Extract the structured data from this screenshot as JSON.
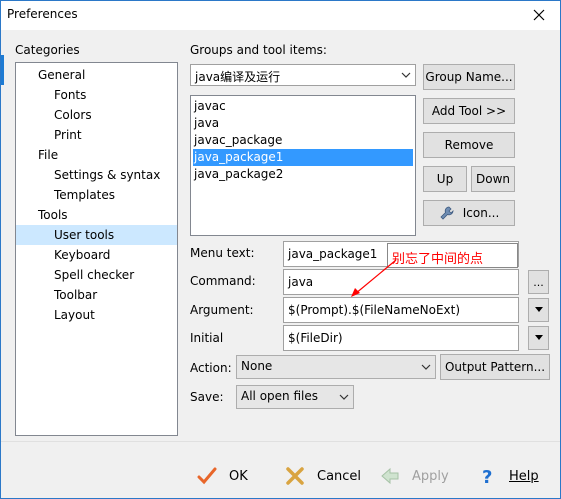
{
  "window": {
    "title": "Preferences",
    "close_icon": "close-icon"
  },
  "categories": {
    "label": "Categories",
    "items": [
      {
        "label": "General",
        "level": 0,
        "selected": false
      },
      {
        "label": "Fonts",
        "level": 1,
        "selected": false
      },
      {
        "label": "Colors",
        "level": 1,
        "selected": false
      },
      {
        "label": "Print",
        "level": 1,
        "selected": false
      },
      {
        "label": "File",
        "level": 0,
        "selected": false
      },
      {
        "label": "Settings & syntax",
        "level": 1,
        "selected": false
      },
      {
        "label": "Templates",
        "level": 1,
        "selected": false
      },
      {
        "label": "Tools",
        "level": 0,
        "selected": false
      },
      {
        "label": "User tools",
        "level": 1,
        "selected": true
      },
      {
        "label": "Keyboard",
        "level": 1,
        "selected": false
      },
      {
        "label": "Spell checker",
        "level": 1,
        "selected": false
      },
      {
        "label": "Toolbar",
        "level": 1,
        "selected": false
      },
      {
        "label": "Layout",
        "level": 1,
        "selected": false
      }
    ]
  },
  "groups": {
    "label": "Groups and tool items:",
    "selected_group": "java编译及运行",
    "group_name_button": "Group Name...",
    "add_tool_button": "Add Tool >>",
    "remove_button": "Remove",
    "up_button": "Up",
    "down_button": "Down",
    "icon_button": "Icon...",
    "items": [
      {
        "label": "javac",
        "selected": false
      },
      {
        "label": "java",
        "selected": false
      },
      {
        "label": "javac_package",
        "selected": false
      },
      {
        "label": "java_package1",
        "selected": true
      },
      {
        "label": "java_package2",
        "selected": false
      }
    ]
  },
  "form": {
    "menu_text_label": "Menu text:",
    "menu_text_value": "java_package1",
    "command_label": "Command:",
    "command_value": "java",
    "command_browse": "...",
    "argument_label": "Argument:",
    "argument_value": "$(Prompt).$(FileNameNoExt)",
    "initial_label": "Initial",
    "initial_value": "$(FileDir)",
    "action_label": "Action:",
    "action_value": "None",
    "output_pattern_button": "Output Pattern...",
    "save_label": "Save:",
    "save_value": "All open files"
  },
  "annotation": {
    "text": "别忘了中间的点",
    "color": "#ff0000"
  },
  "buttons": {
    "ok": "OK",
    "cancel": "Cancel",
    "apply": "Apply",
    "help": "Help"
  },
  "colors": {
    "selection": "#3399ff",
    "tree_selection": "#cce8ff",
    "ok_check": "#e8662a",
    "cancel_x": "#d9a441",
    "help_question": "#1e6fd0"
  }
}
